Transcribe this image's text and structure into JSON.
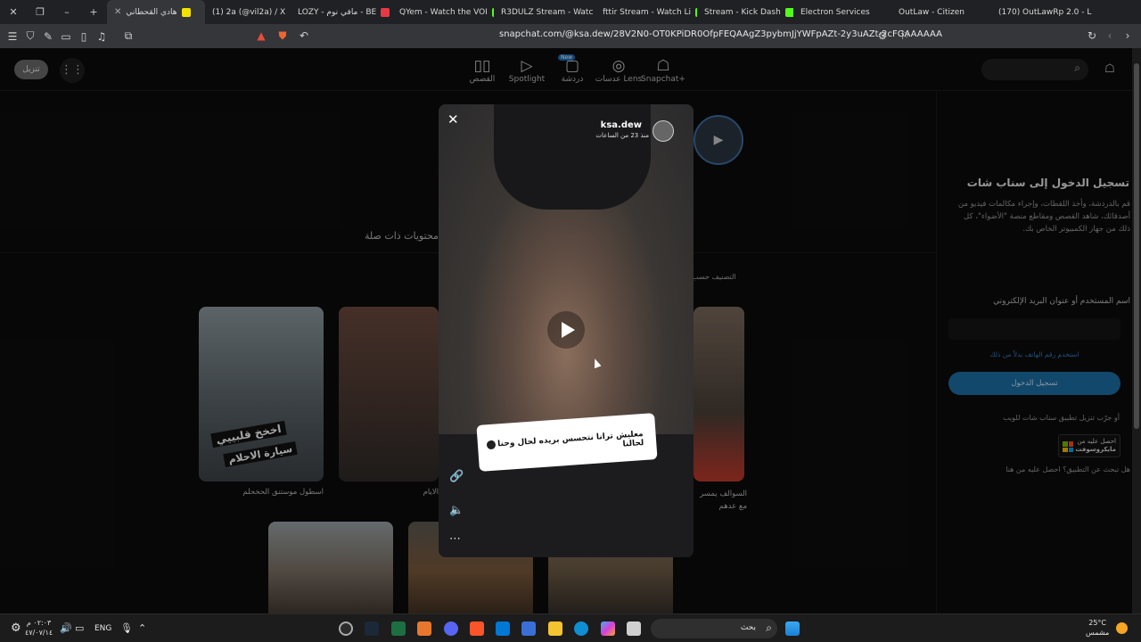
{
  "browser": {
    "tabs": [
      {
        "label": "هادي القحطاني",
        "active": true,
        "color": "#f2e200"
      },
      {
        "label": "(1) 2a (@vil2a) / X",
        "color": "#222222"
      },
      {
        "label": "LOZY - مافي نوم - BE",
        "color": "#e63946"
      },
      {
        "label": "QYem - Watch the VOI",
        "color": "#53fc18"
      },
      {
        "label": "R3DULZ Stream - Watc",
        "color": "#53fc18"
      },
      {
        "label": "fttir Stream - Watch Li",
        "color": "#53fc18"
      },
      {
        "label": "Stream - Kick Dash",
        "color": "#53fc18"
      },
      {
        "label": "Electron Services",
        "color": "#3b8ad9"
      },
      {
        "label": "OutLaw - Citizen",
        "color": "#2b9a66"
      },
      {
        "label": "(170) OutLawRp 2.0 - L",
        "color": "#cc2b2b"
      }
    ],
    "url": "snapchat.com/@ksa.dew/28V2N0-OT0KPiDR0OfpFEQAAgZ3pybmJjYWFpAZt-2y3uAZt-2cFGAAAAAA"
  },
  "header": {
    "nav": [
      "القصص",
      "Spotlight",
      "دردشة",
      "عدسات Lens",
      "Snapchat+"
    ],
    "new_badge": "New",
    "download": "تنزيل"
  },
  "video": {
    "username": "ksa.dew",
    "time": "منذ 23 من الساعات",
    "sticker_text": "معليش ترانا نتحسس بريده لحال وحنا لحالنا"
  },
  "related": {
    "title": "محتويات ذات صلة",
    "sort": "التصنيف حسب",
    "cards": [
      {
        "caption": "اسطول موستنق الحخحلم",
        "overlay1": "اخخخ قلبييي",
        "overlay2": "سيارة الاحلام"
      },
      {
        "caption": "الايام"
      },
      {
        "caption": "السوالف يمسر مع عدهم"
      }
    ]
  },
  "login": {
    "title": "تسجيل الدخول إلى سناب شات",
    "desc": "قم بالدردشة، وأخذ اللقطات، وإجراء مكالمات فيديو من أصدقائك، شاهد القصص ومقاطع منصة \"الأضواء\"، كل ذلك من جهاز الكمبيوتر الخاص بك.",
    "field_label": "اسم المستخدم أو عنوان البريد الإلكتروني",
    "alt_link": "استخدم رقم الهاتف بدلاً من ذلك",
    "button": "تسجيل الدخول",
    "download_hint": "أو جرّب تنزيل تطبيق سناب شات للويب",
    "ms_line1": "احصل عليه من",
    "ms_line2": "مايكروسوفت",
    "help": "هل تبحث عن التطبيق؟ احصل عليه من هنا"
  },
  "taskbar": {
    "time": "٠٢:٠٣ م",
    "date": "٤٧/٠٧/١٤",
    "lang": "ENG",
    "search": "بحث",
    "temp": "25°C",
    "weather": "مشمس"
  }
}
